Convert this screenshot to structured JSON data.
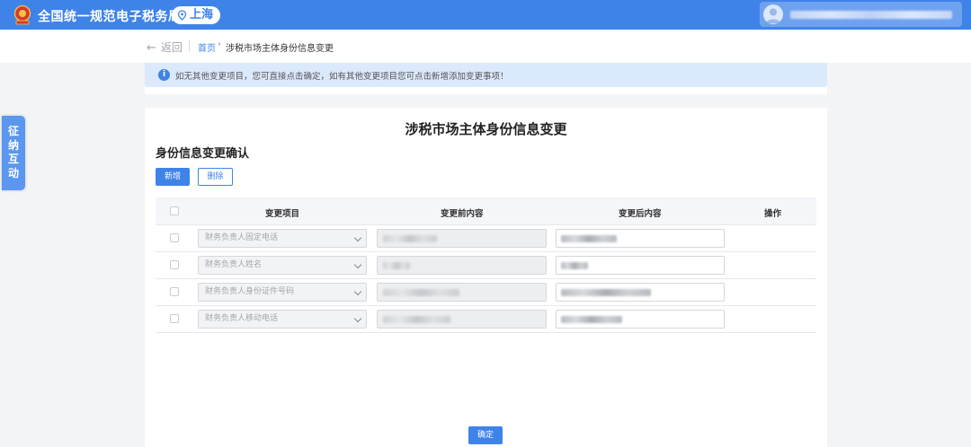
{
  "header": {
    "site_title": "全国统一规范电子税务局",
    "region": "上海",
    "brand_color": "#3f83e8",
    "icons": [
      "national-emblem-icon",
      "location-pin-icon",
      "user-avatar-icon"
    ]
  },
  "breadcrumb": {
    "back_label": "返回",
    "home_label": "首页",
    "current_label": "涉税市场主体身份信息变更"
  },
  "notice": {
    "text": "如无其他变更项目，您可直接点击确定，如有其他变更项目您可点击新增添加变更事项！"
  },
  "side_tab": {
    "chars": [
      "征",
      "纳",
      "互",
      "动"
    ]
  },
  "main": {
    "title": "涉税市场主体身份信息变更",
    "section_title": "身份信息变更确认",
    "add_label": "新增",
    "delete_label": "删除",
    "confirm_label": "确定",
    "table": {
      "columns": [
        "变更项目",
        "变更前内容",
        "变更后内容",
        "操作"
      ],
      "rows": [
        {
          "item": "财务负责人固定电话"
        },
        {
          "item": "财务负责人姓名"
        },
        {
          "item": "财务负责人身份证件号码"
        },
        {
          "item": "财务负责人移动电话"
        }
      ]
    }
  }
}
